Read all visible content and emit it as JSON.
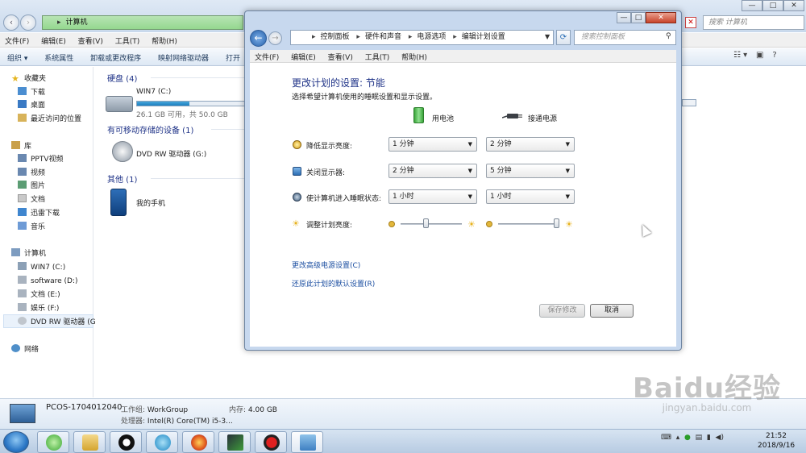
{
  "explorer": {
    "address": "计算机",
    "search_placeholder": "搜索 计算机",
    "close_glyph": "✕",
    "win_min": "—",
    "win_max": "□",
    "win_close": "✕",
    "menu": [
      "文件(F)",
      "编辑(E)",
      "查看(V)",
      "工具(T)",
      "帮助(H)"
    ],
    "toolbar": [
      "组织 ▾",
      "系统属性",
      "卸载或更改程序",
      "映射网络驱动器",
      "打开"
    ],
    "sidebar": {
      "favorites_head": "收藏夹",
      "favorites": [
        "下载",
        "桌面",
        "最近访问的位置"
      ],
      "library_head": "库",
      "libraries": [
        "PPTV视频",
        "视频",
        "图片",
        "文档",
        "迅雷下载",
        "音乐"
      ],
      "computer_head": "计算机",
      "drives": [
        "WIN7 (C:)",
        "software (D:)",
        "文档 (E:)",
        "娱乐 (F:)",
        "DVD RW 驱动器 (G"
      ],
      "network": "网络"
    },
    "groups": {
      "hdd": "硬盘 (4)",
      "removable": "有可移动存储的设备 (1)",
      "other": "其他 (1)"
    },
    "drive_c": {
      "name": "WIN7 (C:)",
      "free": "26.1 GB 可用，共 50.0 GB",
      "used_fraction": 0.48
    },
    "dvd": "DVD RW 驱动器 (G:)",
    "phone": "我的手机",
    "details": {
      "pc_name": "PCOS-1704012040",
      "workgroup_label": "工作组:",
      "workgroup": "WorkGroup",
      "memory_label": "内存:",
      "memory": "4.00 GB",
      "cpu_label": "处理器:",
      "cpu": "Intel(R) Core(TM) i5-3..."
    }
  },
  "dialog": {
    "breadcrumb": [
      "控制面板",
      "硬件和声音",
      "电源选项",
      "编辑计划设置"
    ],
    "search_placeholder": "搜索控制面板",
    "menu": [
      "文件(F)",
      "编辑(E)",
      "查看(V)",
      "工具(T)",
      "帮助(H)"
    ],
    "title": "更改计划的设置: 节能",
    "subtitle": "选择希望计算机使用的睡眠设置和显示设置。",
    "col_battery": "用电池",
    "col_plugged": "接通电源",
    "rows": [
      {
        "label": "降低显示亮度:",
        "battery": "1 分钟",
        "plugged": "2 分钟"
      },
      {
        "label": "关闭显示器:",
        "battery": "2 分钟",
        "plugged": "5 分钟"
      },
      {
        "label": "使计算机进入睡眠状态:",
        "battery": "1 小时",
        "plugged": "1 小时"
      }
    ],
    "brightness_label": "调整计划亮度:",
    "brightness_battery": 0.4,
    "brightness_plugged": 1.0,
    "link_advanced": "更改高级电源设置(C)",
    "link_restore": "还原此计划的默认设置(R)",
    "btn_save": "保存修改",
    "btn_cancel": "取消"
  },
  "taskbar": {
    "time": "21:52",
    "date": "2018/9/16"
  },
  "watermark": {
    "main": "Baidu经验",
    "sub": "jingyan.baidu.com"
  },
  "colors": {
    "link": "#1e50a2",
    "heading": "#1e3287",
    "drive_fill": "#1b7fc0"
  }
}
